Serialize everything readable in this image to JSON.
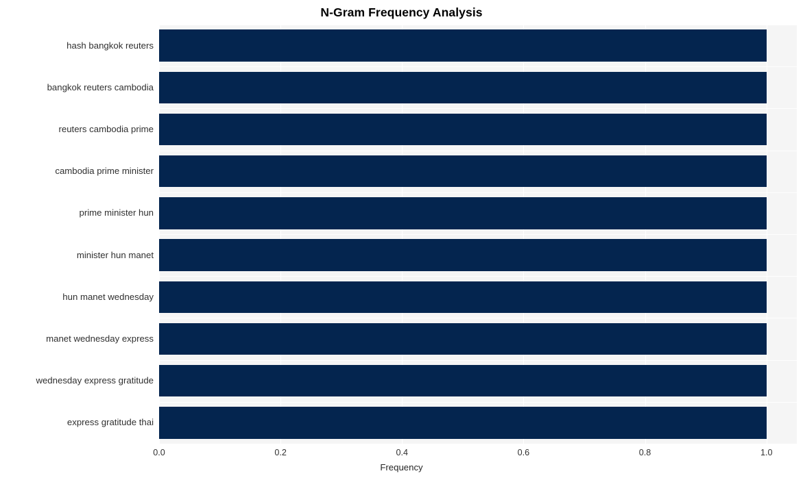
{
  "chart_data": {
    "type": "bar",
    "orientation": "horizontal",
    "title": "N-Gram Frequency Analysis",
    "xlabel": "Frequency",
    "ylabel": "",
    "categories": [
      "hash bangkok reuters",
      "bangkok reuters cambodia",
      "reuters cambodia prime",
      "cambodia prime minister",
      "prime minister hun",
      "minister hun manet",
      "hun manet wednesday",
      "manet wednesday express",
      "wednesday express gratitude",
      "express gratitude thai"
    ],
    "values": [
      1.0,
      1.0,
      1.0,
      1.0,
      1.0,
      1.0,
      1.0,
      1.0,
      1.0,
      1.0
    ],
    "xlim": [
      0.0,
      1.05
    ],
    "xticks": [
      "0.0",
      "0.2",
      "0.4",
      "0.6",
      "0.8",
      "1.0"
    ],
    "xtick_values": [
      0.0,
      0.2,
      0.4,
      0.6,
      0.8,
      1.0
    ],
    "grid": true,
    "legend": false,
    "bar_color": "#04254f",
    "plot_background": "#f5f5f5",
    "figure_background": "#ffffff"
  }
}
